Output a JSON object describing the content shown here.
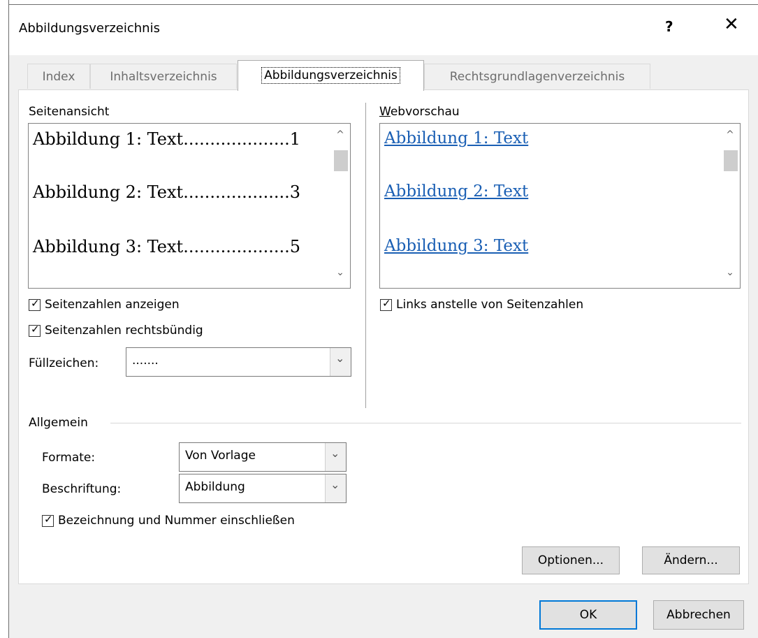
{
  "window": {
    "title": "Abbildungsverzeichnis",
    "help_label": "?",
    "close_label": "✕"
  },
  "tabs": [
    {
      "label": "Index",
      "active": false
    },
    {
      "label": "Inhaltsverzeichnis",
      "active": false
    },
    {
      "label": "Abbildungsverzeichnis",
      "active": true
    },
    {
      "label": "Rechtsgrundlagenverzeichnis",
      "active": false
    }
  ],
  "print_preview": {
    "label": "Seitenansicht",
    "entries": [
      "Abbildung 1: Text....................1",
      "Abbildung 2: Text....................3",
      "Abbildung 3: Text....................5"
    ]
  },
  "web_preview": {
    "label": "Webvorschau",
    "entries": [
      "Abbildung 1: Text",
      "Abbildung 2: Text",
      "Abbildung 3: Text"
    ],
    "link_color": "#1a5fb4"
  },
  "options": {
    "show_page_numbers": {
      "label": "Seitenzahlen anzeigen",
      "checked": true
    },
    "right_align": {
      "label": "Seitenzahlen rechtsbündig",
      "checked": true
    },
    "tab_leader": {
      "label": "Füllzeichen:",
      "value": "......."
    },
    "hyperlinks": {
      "label": "Links anstelle von Seitenzahlen",
      "checked": true
    }
  },
  "general": {
    "section_label": "Allgemein",
    "formats": {
      "label": "Formate:",
      "value": "Von Vorlage"
    },
    "caption": {
      "label": "Beschriftung:",
      "value": "Abbildung"
    },
    "include_label": {
      "label": "Bezeichnung und Nummer einschließen",
      "checked": true
    }
  },
  "buttons": {
    "options": "Optionen...",
    "modify": "Ändern...",
    "ok": "OK",
    "cancel": "Abbrechen"
  },
  "icons": {
    "scroll_up": "^",
    "scroll_down": "⌄",
    "dropdown": "⌄",
    "check": "✓"
  },
  "colors": {
    "accent": "#0078d7",
    "dialog_bg": "#f0f0f0"
  }
}
